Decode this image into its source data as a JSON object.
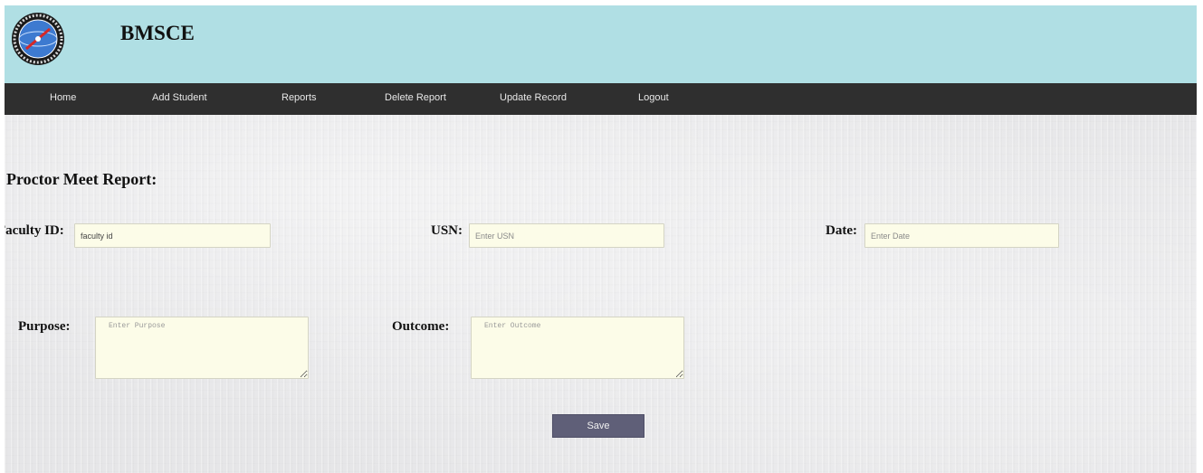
{
  "header": {
    "brand": "BMSCE",
    "logo_icon": "college-emblem-icon",
    "background_color": "#b0dfe4"
  },
  "nav": {
    "items": [
      {
        "label": "Home"
      },
      {
        "label": "Add Student"
      },
      {
        "label": "Reports"
      },
      {
        "label": "Delete Report"
      },
      {
        "label": "Update Record"
      },
      {
        "label": "Logout"
      }
    ],
    "background_color": "#2f2f2f"
  },
  "form": {
    "title": "Proctor Meet Report:",
    "faculty_id": {
      "label": "Faculty ID:",
      "value": "faculty id",
      "placeholder": ""
    },
    "usn": {
      "label": "USN:",
      "value": "",
      "placeholder": "Enter USN"
    },
    "date": {
      "label": "Date:",
      "value": "",
      "placeholder": "Enter Date"
    },
    "purpose": {
      "label": "Purpose:",
      "placeholder": "Enter Purpose"
    },
    "outcome": {
      "label": "Outcome:",
      "placeholder": "Enter Outcome"
    },
    "save_label": "Save",
    "field_background": "#fcfce8",
    "button_color": "#5f5f78"
  }
}
